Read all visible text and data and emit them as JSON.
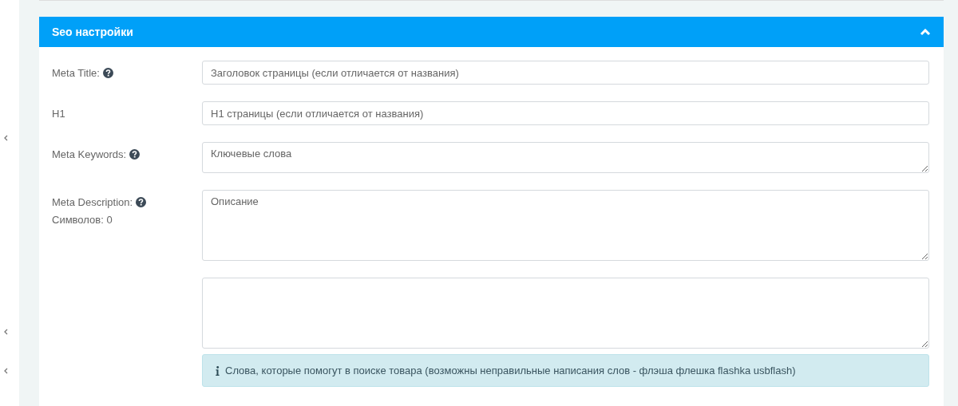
{
  "panel": {
    "title": "Seo настройки",
    "expanded": true
  },
  "fields": [
    {
      "kind": "input",
      "label": "Meta Title:",
      "help": true,
      "placeholder": "Заголовок страницы (если отличается от названия)"
    },
    {
      "kind": "input",
      "label": "H1",
      "help": false,
      "placeholder": "H1 страницы (если отличается от названия)"
    },
    {
      "kind": "short-textarea",
      "label": "Meta Keywords:",
      "help": true,
      "placeholder": "Ключевые слова"
    },
    {
      "kind": "textarea",
      "label": "Meta Description:",
      "help": true,
      "counter": "Символов: 0",
      "placeholder": "Описание"
    },
    {
      "kind": "textarea"
    }
  ],
  "hint": "Слова, которые помогут в поиске товара (возможны неправильные написания слов - флэша флешка flashka usbflash)"
}
